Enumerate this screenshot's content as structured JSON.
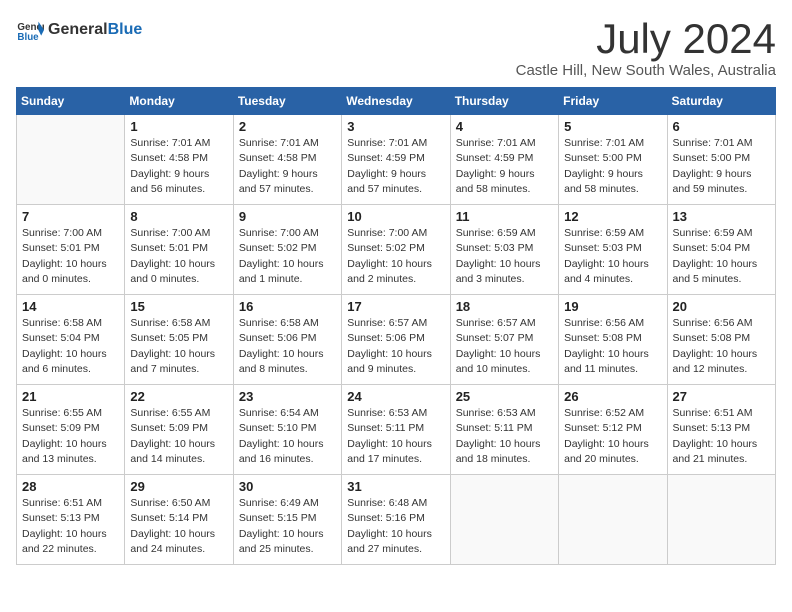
{
  "header": {
    "logo_general": "General",
    "logo_blue": "Blue",
    "month_title": "July 2024",
    "location": "Castle Hill, New South Wales, Australia"
  },
  "days_of_week": [
    "Sunday",
    "Monday",
    "Tuesday",
    "Wednesday",
    "Thursday",
    "Friday",
    "Saturday"
  ],
  "weeks": [
    [
      {
        "day": "",
        "sunrise": "",
        "sunset": "",
        "daylight": ""
      },
      {
        "day": "1",
        "sunrise": "Sunrise: 7:01 AM",
        "sunset": "Sunset: 4:58 PM",
        "daylight": "Daylight: 9 hours and 56 minutes."
      },
      {
        "day": "2",
        "sunrise": "Sunrise: 7:01 AM",
        "sunset": "Sunset: 4:58 PM",
        "daylight": "Daylight: 9 hours and 57 minutes."
      },
      {
        "day": "3",
        "sunrise": "Sunrise: 7:01 AM",
        "sunset": "Sunset: 4:59 PM",
        "daylight": "Daylight: 9 hours and 57 minutes."
      },
      {
        "day": "4",
        "sunrise": "Sunrise: 7:01 AM",
        "sunset": "Sunset: 4:59 PM",
        "daylight": "Daylight: 9 hours and 58 minutes."
      },
      {
        "day": "5",
        "sunrise": "Sunrise: 7:01 AM",
        "sunset": "Sunset: 5:00 PM",
        "daylight": "Daylight: 9 hours and 58 minutes."
      },
      {
        "day": "6",
        "sunrise": "Sunrise: 7:01 AM",
        "sunset": "Sunset: 5:00 PM",
        "daylight": "Daylight: 9 hours and 59 minutes."
      }
    ],
    [
      {
        "day": "7",
        "sunrise": "Sunrise: 7:00 AM",
        "sunset": "Sunset: 5:01 PM",
        "daylight": "Daylight: 10 hours and 0 minutes."
      },
      {
        "day": "8",
        "sunrise": "Sunrise: 7:00 AM",
        "sunset": "Sunset: 5:01 PM",
        "daylight": "Daylight: 10 hours and 0 minutes."
      },
      {
        "day": "9",
        "sunrise": "Sunrise: 7:00 AM",
        "sunset": "Sunset: 5:02 PM",
        "daylight": "Daylight: 10 hours and 1 minute."
      },
      {
        "day": "10",
        "sunrise": "Sunrise: 7:00 AM",
        "sunset": "Sunset: 5:02 PM",
        "daylight": "Daylight: 10 hours and 2 minutes."
      },
      {
        "day": "11",
        "sunrise": "Sunrise: 6:59 AM",
        "sunset": "Sunset: 5:03 PM",
        "daylight": "Daylight: 10 hours and 3 minutes."
      },
      {
        "day": "12",
        "sunrise": "Sunrise: 6:59 AM",
        "sunset": "Sunset: 5:03 PM",
        "daylight": "Daylight: 10 hours and 4 minutes."
      },
      {
        "day": "13",
        "sunrise": "Sunrise: 6:59 AM",
        "sunset": "Sunset: 5:04 PM",
        "daylight": "Daylight: 10 hours and 5 minutes."
      }
    ],
    [
      {
        "day": "14",
        "sunrise": "Sunrise: 6:58 AM",
        "sunset": "Sunset: 5:04 PM",
        "daylight": "Daylight: 10 hours and 6 minutes."
      },
      {
        "day": "15",
        "sunrise": "Sunrise: 6:58 AM",
        "sunset": "Sunset: 5:05 PM",
        "daylight": "Daylight: 10 hours and 7 minutes."
      },
      {
        "day": "16",
        "sunrise": "Sunrise: 6:58 AM",
        "sunset": "Sunset: 5:06 PM",
        "daylight": "Daylight: 10 hours and 8 minutes."
      },
      {
        "day": "17",
        "sunrise": "Sunrise: 6:57 AM",
        "sunset": "Sunset: 5:06 PM",
        "daylight": "Daylight: 10 hours and 9 minutes."
      },
      {
        "day": "18",
        "sunrise": "Sunrise: 6:57 AM",
        "sunset": "Sunset: 5:07 PM",
        "daylight": "Daylight: 10 hours and 10 minutes."
      },
      {
        "day": "19",
        "sunrise": "Sunrise: 6:56 AM",
        "sunset": "Sunset: 5:08 PM",
        "daylight": "Daylight: 10 hours and 11 minutes."
      },
      {
        "day": "20",
        "sunrise": "Sunrise: 6:56 AM",
        "sunset": "Sunset: 5:08 PM",
        "daylight": "Daylight: 10 hours and 12 minutes."
      }
    ],
    [
      {
        "day": "21",
        "sunrise": "Sunrise: 6:55 AM",
        "sunset": "Sunset: 5:09 PM",
        "daylight": "Daylight: 10 hours and 13 minutes."
      },
      {
        "day": "22",
        "sunrise": "Sunrise: 6:55 AM",
        "sunset": "Sunset: 5:09 PM",
        "daylight": "Daylight: 10 hours and 14 minutes."
      },
      {
        "day": "23",
        "sunrise": "Sunrise: 6:54 AM",
        "sunset": "Sunset: 5:10 PM",
        "daylight": "Daylight: 10 hours and 16 minutes."
      },
      {
        "day": "24",
        "sunrise": "Sunrise: 6:53 AM",
        "sunset": "Sunset: 5:11 PM",
        "daylight": "Daylight: 10 hours and 17 minutes."
      },
      {
        "day": "25",
        "sunrise": "Sunrise: 6:53 AM",
        "sunset": "Sunset: 5:11 PM",
        "daylight": "Daylight: 10 hours and 18 minutes."
      },
      {
        "day": "26",
        "sunrise": "Sunrise: 6:52 AM",
        "sunset": "Sunset: 5:12 PM",
        "daylight": "Daylight: 10 hours and 20 minutes."
      },
      {
        "day": "27",
        "sunrise": "Sunrise: 6:51 AM",
        "sunset": "Sunset: 5:13 PM",
        "daylight": "Daylight: 10 hours and 21 minutes."
      }
    ],
    [
      {
        "day": "28",
        "sunrise": "Sunrise: 6:51 AM",
        "sunset": "Sunset: 5:13 PM",
        "daylight": "Daylight: 10 hours and 22 minutes."
      },
      {
        "day": "29",
        "sunrise": "Sunrise: 6:50 AM",
        "sunset": "Sunset: 5:14 PM",
        "daylight": "Daylight: 10 hours and 24 minutes."
      },
      {
        "day": "30",
        "sunrise": "Sunrise: 6:49 AM",
        "sunset": "Sunset: 5:15 PM",
        "daylight": "Daylight: 10 hours and 25 minutes."
      },
      {
        "day": "31",
        "sunrise": "Sunrise: 6:48 AM",
        "sunset": "Sunset: 5:16 PM",
        "daylight": "Daylight: 10 hours and 27 minutes."
      },
      {
        "day": "",
        "sunrise": "",
        "sunset": "",
        "daylight": ""
      },
      {
        "day": "",
        "sunrise": "",
        "sunset": "",
        "daylight": ""
      },
      {
        "day": "",
        "sunrise": "",
        "sunset": "",
        "daylight": ""
      }
    ]
  ]
}
